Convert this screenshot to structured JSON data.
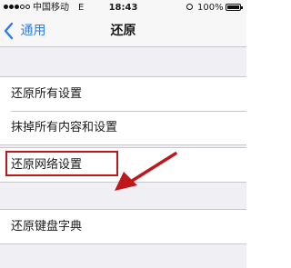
{
  "status_bar": {
    "carrier": "中国移动",
    "network": "E",
    "time": "18:43",
    "battery": "100%"
  },
  "nav": {
    "back_label": "通用",
    "title": "还原"
  },
  "groups": [
    {
      "items": [
        "还原所有设置",
        "抹掉所有内容和设置"
      ]
    },
    {
      "items": [
        "还原网络设置"
      ]
    },
    {
      "items": [
        "还原键盘字典"
      ]
    }
  ],
  "annotation": {
    "highlight_color": "#c0171b",
    "highlighted_item": "还原网络设置"
  },
  "colors": {
    "accent": "#2a7bf5",
    "background": "#efeff4"
  },
  "icons": [
    "alarm-icon",
    "battery-icon",
    "back-chevron-icon",
    "red-arrow-icon"
  ]
}
